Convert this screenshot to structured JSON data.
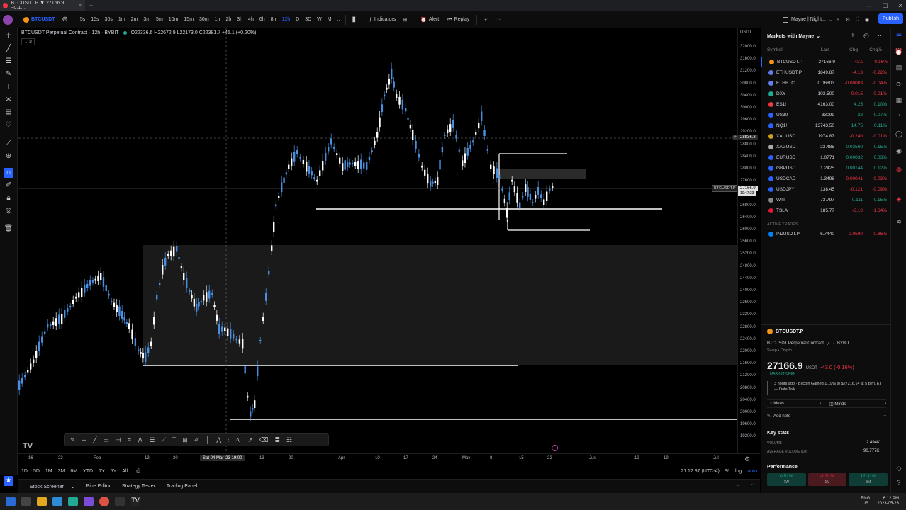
{
  "browser": {
    "tab_title": "BTCUSDT.P ▼ 27166.9 −0.1…",
    "window_controls": [
      "—",
      "☐",
      "✕"
    ]
  },
  "toolbar": {
    "symbol": "BTCUSDT",
    "timeframes": [
      "5s",
      "15s",
      "30s",
      "1m",
      "2m",
      "3m",
      "5m",
      "10m",
      "15m",
      "30m",
      "1h",
      "2h",
      "3h",
      "4h",
      "6h",
      "8h",
      "12h",
      "D",
      "3D",
      "W",
      "M"
    ],
    "active_timeframe": "12h",
    "indicators_label": "Indicators",
    "alert_label": "Alert",
    "replay_label": "Replay",
    "layout_name": "Mayne | Night...",
    "publish_label": "Publish"
  },
  "chart": {
    "title": "BTCUSDT Perpetual Contract · 12h · BYBIT",
    "ohlc": "O22336.6 H22672.9 L22173.0 C22381.7 +45.1 (+0.20%)",
    "indicator_count": "2",
    "crosshair_time": "Sat 04 Mar '23  19:00",
    "crosshair_price": "28836.8",
    "last_price_label": "BTCUSDT.P",
    "last_price_value": "27166.9",
    "last_price_countdown": "10:47:23",
    "clock": "21:12:37 (UTC-4)",
    "price_axis_currency": "USDT",
    "price_ticks": [
      "32000.0",
      "31600.0",
      "31200.0",
      "30800.0",
      "30400.0",
      "30000.0",
      "29600.0",
      "29200.0",
      "28800.0",
      "28400.0",
      "28000.0",
      "27600.0",
      "27200.0",
      "26800.0",
      "26400.0",
      "26000.0",
      "25600.0",
      "25200.0",
      "24800.0",
      "24400.0",
      "24000.0",
      "23600.0",
      "23200.0",
      "22800.0",
      "22400.0",
      "22000.0",
      "21600.0",
      "21200.0",
      "20800.0",
      "20400.0",
      "20000.0",
      "19600.0",
      "19200.0"
    ],
    "time_ticks": [
      "16",
      "Feb",
      "23",
      "13",
      "20",
      "13",
      "20",
      "Apr",
      "10",
      "17",
      "24",
      "May",
      "8",
      "15",
      "22",
      "Jun",
      "12",
      "19",
      "Jul"
    ],
    "ranges": [
      "1D",
      "5D",
      "1M",
      "3M",
      "6M",
      "YTD",
      "1Y",
      "5Y",
      "All"
    ],
    "axis_options": [
      "%",
      "log",
      "auto"
    ]
  },
  "bottom_tabs": [
    "Stock Screener",
    "Pine Editor",
    "Strategy Tester",
    "Trading Panel"
  ],
  "watchlist": {
    "title": "Markets with Mayne",
    "columns": [
      "Symbol",
      "Last",
      "Chg",
      "Chg%"
    ],
    "rows": [
      {
        "sym": "BTCUSDT.P",
        "last": "27166.9",
        "chg": "-43.0",
        "chgp": "-0.16%",
        "dir": "neg",
        "color": "#f7931a"
      },
      {
        "sym": "ETHUSDT.P",
        "last": "1849.87",
        "chg": "-4.13",
        "chgp": "-0.22%",
        "dir": "neg",
        "color": "#627eea",
        "last_dir": "neg"
      },
      {
        "sym": "ETHBTC",
        "last": "0.06803",
        "chg": "-0.00003",
        "chgp": "-0.04%",
        "dir": "neg",
        "color": "#627eea"
      },
      {
        "sym": "DXY",
        "last": "103.500",
        "chg": "-0.015",
        "chgp": "-0.01%",
        "dir": "neg",
        "color": "#22ab94"
      },
      {
        "sym": "ES1!",
        "last": "4163.00",
        "chg": "4.25",
        "chgp": "0.10%",
        "dir": "pos",
        "color": "#f23645"
      },
      {
        "sym": "US30",
        "last": "33099",
        "chg": "22",
        "chgp": "0.07%",
        "dir": "pos",
        "color": "#2962ff",
        "last_dir": "neg"
      },
      {
        "sym": "NQ1!",
        "last": "13743.50",
        "chg": "14.75",
        "chgp": "0.11%",
        "dir": "pos",
        "color": "#2962ff"
      },
      {
        "sym": "XAUUSD",
        "last": "1974.87",
        "chg": "-0.240",
        "chgp": "-0.01%",
        "dir": "neg",
        "color": "#d4a017",
        "last_dir": "neg"
      },
      {
        "sym": "XAGUSD",
        "last": "23.485",
        "chg": "0.03560",
        "chgp": "0.15%",
        "dir": "pos",
        "color": "#aaaaaa"
      },
      {
        "sym": "EURUSD",
        "last": "1.0771",
        "chg": "0.00032",
        "chgp": "0.03%",
        "dir": "pos",
        "color": "#2962ff"
      },
      {
        "sym": "GBPUSD",
        "last": "1.2425",
        "chg": "0.00144",
        "chgp": "0.12%",
        "dir": "pos",
        "color": "#2962ff"
      },
      {
        "sym": "USDCAD",
        "last": "1.3498",
        "chg": "-0.00041",
        "chgp": "-0.03%",
        "dir": "neg",
        "color": "#2962ff"
      },
      {
        "sym": "USDJPY",
        "last": "138.45",
        "chg": "-0.121",
        "chgp": "-0.09%",
        "dir": "neg",
        "color": "#2962ff"
      },
      {
        "sym": "WTI",
        "last": "73.797",
        "chg": "0.111",
        "chgp": "0.15%",
        "dir": "pos",
        "color": "#888888",
        "last_dir": "neg"
      },
      {
        "sym": "TSLA",
        "last": "185.77",
        "chg": "-3.10",
        "chgp": "-1.64%",
        "dir": "neg",
        "color": "#e31937"
      }
    ],
    "section_label": "ACTIVE TRADES",
    "active": {
      "sym": "INJUSDT.P",
      "last": "6.7440",
      "chg": "-0.0580",
      "chgp": "-0.86%",
      "dir": "neg",
      "color": "#0082fa"
    }
  },
  "details": {
    "symbol": "BTCUSDT.P",
    "name": "BTCUSDT Perpetual Contract",
    "exchange": "BYBIT",
    "type": "Swap • Crypto",
    "price": "27166.9",
    "currency": "USDT",
    "change": "-43.0 (-0.16%)",
    "market_status": "MARKET OPEN",
    "news": "3 hours ago · Bitcoin Gained 1.19% to $27216.14 at 5 p.m. ET — Data Talk",
    "ideas_label": "Ideas",
    "minds_label": "Minds",
    "add_note_label": "Add note",
    "key_stats_label": "Key stats",
    "volume_label": "VOLUME",
    "volume_value": "2.494K",
    "avg_volume_label": "AVERAGE VOLUME (10)",
    "avg_volume_value": "90.777K",
    "performance_label": "Performance",
    "performance": [
      {
        "value": "0.51%",
        "period": "1W",
        "dir": "pos"
      },
      {
        "value": "-1.51%",
        "period": "1M",
        "dir": "neg"
      },
      {
        "value": "12.31%",
        "period": "3M",
        "dir": "pos"
      }
    ]
  },
  "system": {
    "lang": "ENG",
    "region": "US",
    "time": "6:12 PM",
    "date": "2023-05-23"
  }
}
